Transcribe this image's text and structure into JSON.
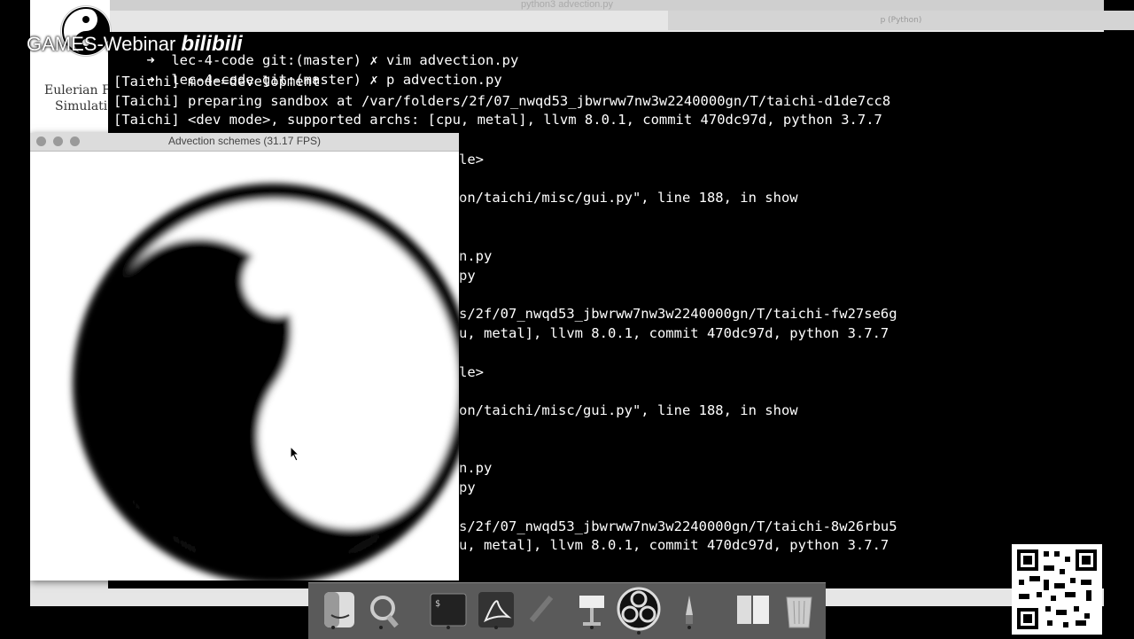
{
  "background_window": {
    "title": "python3 advection.py",
    "tab_right": "p (Python)"
  },
  "slide": {
    "line1": "Eulerian F",
    "line2": "Simulatio"
  },
  "watermark": {
    "text": "GAMES-Webinar",
    "brand": "bilibili"
  },
  "terminal": {
    "lines": [
      {
        "prompt": "➜",
        "dir": "lec-4-code",
        "git": "git:(master)",
        "x": "✗",
        "cmd": "vim advection.py"
      },
      {
        "prompt": "➜",
        "dir": "lec-4-code",
        "git": "git:(master)",
        "x": "✗",
        "cmd": "p advection.py"
      }
    ],
    "output": [
      "[Taichi] mode=development",
      "[Taichi] preparing sandbox at /var/folders/2f/07_nwqd53_jbwrww7nw3w2240000gn/T/taichi-d1de7cc8",
      "[Taichi] <dev mode>, supported archs: [cpu, metal], llvm 8.0.1, commit 470dc97d, python 3.7.7"
    ],
    "partial": [
      "le>",
      "on/taichi/misc/gui.py\", line 188, in show",
      "n.py",
      "py",
      "s/2f/07_nwqd53_jbwrww7nw3w2240000gn/T/taichi-fw27se6g",
      "u, metal], llvm 8.0.1, commit 470dc97d, python 3.7.7",
      "le>",
      "on/taichi/misc/gui.py\", line 188, in show",
      "n.py",
      "py",
      "s/2f/07_nwqd53_jbwrww7nw3w2240000gn/T/taichi-8w26rbu5",
      "u, metal], llvm 8.0.1, commit 470dc97d, python 3.7.7"
    ]
  },
  "app_window": {
    "title": "Advection schemes (31.17 FPS)"
  },
  "dock": {
    "items": [
      "finder-icon",
      "preview-icon",
      "terminal-icon",
      "acrobat-icon",
      "pen-icon",
      "keynote-icon",
      "obs-icon",
      "brush-icon",
      "files-icon",
      "trash-icon"
    ]
  },
  "colors": {
    "terminal_bg": "#000000",
    "terminal_fg": "#ffffff",
    "dock_bg": "#5a5a5a"
  }
}
